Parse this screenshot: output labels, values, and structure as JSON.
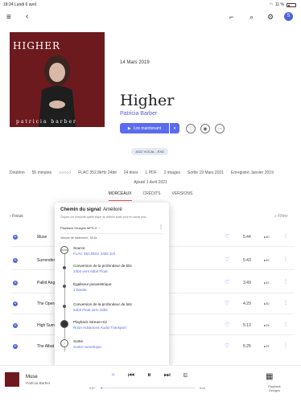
{
  "status": {
    "time": "18:24",
    "date": "Lundi 6 avril",
    "battery": "11 %"
  },
  "topbar": {
    "avatar": "S"
  },
  "album": {
    "cover_title": "HIGHER",
    "cover_artist": "patricia barber",
    "release_date": "14 Mars 2019",
    "title": "Higher",
    "artist": "Patricia Barber",
    "play_label": "Lire maintenant",
    "genre": "JAZZ VOCAL - EXD"
  },
  "meta": {
    "quality_label": "Doublon",
    "duration": "55 minutes",
    "quality_dots": "○○○○○",
    "format": "FLAC 352.8kHz 24bit",
    "tracks": "24 titres",
    "pdf": "1 PDF",
    "images": "2 images",
    "sort": "Sortie 19 Mars 2021",
    "recorded": "Enregistré Janvier 2019",
    "added": "Ajouté 1 Avril 2021"
  },
  "tabs": [
    "MORCEAUX",
    "CRÉDITS",
    "VERSIONS"
  ],
  "filters": {
    "left": "Focus",
    "right": "Filtrer"
  },
  "tracks": [
    {
      "name": "Muse",
      "duration": "5:44",
      "pop": "40"
    },
    {
      "name": "Surrender",
      "duration": "5:43",
      "pop": "40"
    },
    {
      "name": "Pallid Ang",
      "duration": "3:49",
      "pop": "32"
    },
    {
      "name": "The Opera",
      "duration": "4:29",
      "pop": "30"
    },
    {
      "name": "High Sum",
      "duration": "5:13",
      "pop": "29"
    },
    {
      "name": "The Albat",
      "duration": "5:25",
      "pop": "29"
    }
  ],
  "popup": {
    "title": "Chemin du signal",
    "quality": "Amélioré",
    "subtitle": "Cliquez sur n'importe quelle étape du chemin audio pour en savoir plus",
    "device": "Playback Designs MPS-X",
    "rate": "Vitesse de traitement : 53.6x",
    "steps": [
      {
        "name": "Source",
        "value": "FLAC 352.8kHz 24bit 2ch",
        "node": "FLAC"
      },
      {
        "name": "Conversion de la profondeur de bits",
        "value": "24bit vers 64bit Float"
      },
      {
        "name": "Égaliseur paramétrique",
        "value": "1 bande"
      },
      {
        "name": "Conversion de la profondeur de bits",
        "value": "64bit Float vers 32bit"
      },
      {
        "name": "Playback Stream-X2",
        "value": "Roon Advanced Audio Transport"
      },
      {
        "name": "Sortie",
        "value": "Sortie numérique"
      }
    ]
  },
  "player": {
    "track": "Muse",
    "artist": "Patricia Barber",
    "elapsed": "0:07",
    "remaining": "5:44",
    "progress": 0.02,
    "device": "Playback Designs"
  }
}
